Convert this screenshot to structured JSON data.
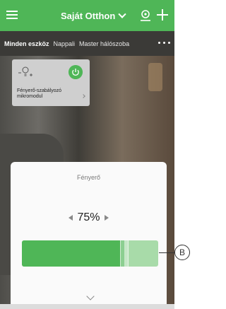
{
  "header": {
    "home_name": "Saját Otthon"
  },
  "tabs": [
    {
      "label": "Minden eszköz",
      "active": true
    },
    {
      "label": "Nappali",
      "active": false
    },
    {
      "label": "Master hálószoba",
      "active": false
    }
  ],
  "device": {
    "name": "Fényerő-szabályozó mikromodul",
    "power_on": true
  },
  "sheet": {
    "title": "Fényerő",
    "value_label": "75%",
    "brightness_fraction": 0.75
  },
  "callout": {
    "label": "B"
  },
  "colors": {
    "accent": "#4fb657",
    "track": "#a8dba9"
  },
  "icons": [
    "menu-icon",
    "chevron-down-icon",
    "user-location-icon",
    "plus-icon",
    "more-icon",
    "bulb-icon",
    "power-icon",
    "arrow-left-icon",
    "arrow-right-icon"
  ]
}
